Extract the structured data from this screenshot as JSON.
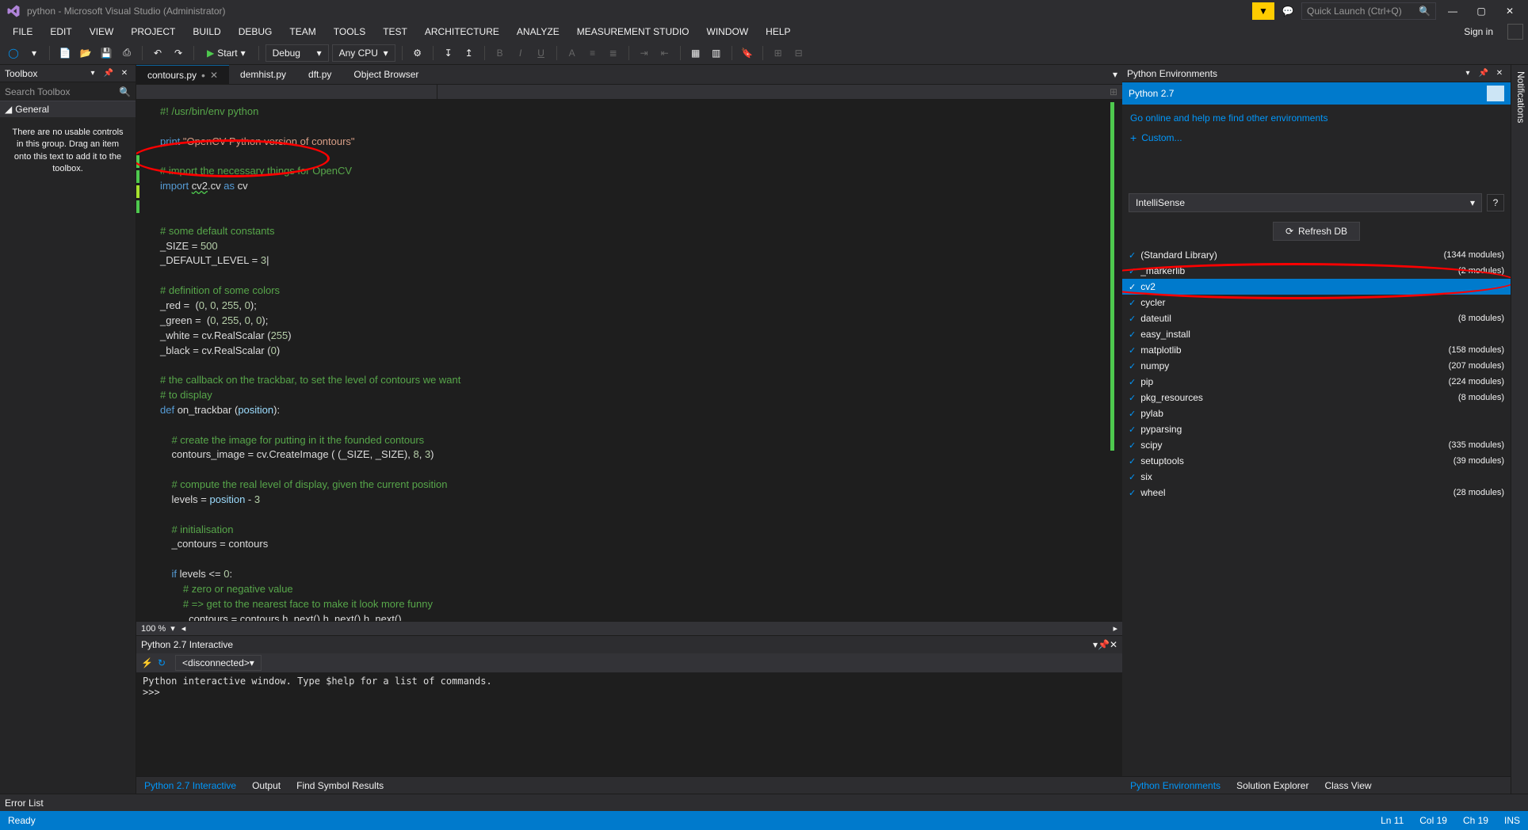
{
  "window": {
    "title": "python - Microsoft Visual Studio (Administrator)",
    "quickLaunchPlaceholder": "Quick Launch (Ctrl+Q)",
    "signIn": "Sign in"
  },
  "menus": [
    "FILE",
    "EDIT",
    "VIEW",
    "PROJECT",
    "BUILD",
    "DEBUG",
    "TEAM",
    "TOOLS",
    "TEST",
    "ARCHITECTURE",
    "ANALYZE",
    "MEASUREMENT STUDIO",
    "WINDOW",
    "HELP"
  ],
  "toolbar": {
    "start": "Start",
    "config": "Debug",
    "platform": "Any CPU"
  },
  "toolbox": {
    "title": "Toolbox",
    "searchPlaceholder": "Search Toolbox",
    "category": "General",
    "message": "There are no usable controls in this group. Drag an item onto this text to add it to the toolbox."
  },
  "tabs": [
    {
      "label": "contours.py",
      "active": true,
      "dirty": true
    },
    {
      "label": "demhist.py",
      "active": false
    },
    {
      "label": "dft.py",
      "active": false
    },
    {
      "label": "Object Browser",
      "active": false
    }
  ],
  "code": "#! /usr/bin/env python\n\nprint \"OpenCV Python version of contours\"\n\n# import the necessary things for OpenCV\nimport cv2.cv as cv\n\n\n# some default constants\n_SIZE = 500\n_DEFAULT_LEVEL = 3\n\n# definition of some colors\n_red =  (0, 0, 255, 0);\n_green =  (0, 255, 0, 0);\n_white = cv.RealScalar (255)\n_black = cv.RealScalar (0)\n\n# the callback on the trackbar, to set the level of contours we want\n# to display\ndef on_trackbar (position):\n\n    # create the image for putting in it the founded contours\n    contours_image = cv.CreateImage ( (_SIZE, _SIZE), 8, 3)\n\n    # compute the real level of display, given the current position\n    levels = position - 3\n\n    # initialisation\n    _contours = contours\n\n    if levels <= 0:\n        # zero or negative value\n        # => get to the nearest face to make it look more funny\n        _contours = contours.h_next().h_next().h_next()",
  "zoom": "100 %",
  "interactive": {
    "title": "Python 2.7 Interactive",
    "state": "<disconnected>",
    "body": "Python interactive window. Type $help for a list of commands.\n>>>",
    "tabs": [
      "Python 2.7 Interactive",
      "Output",
      "Find Symbol Results"
    ]
  },
  "pyenv": {
    "title": "Python Environments",
    "envName": "Python 2.7",
    "link": "Go online and help me find other environments",
    "custom": "Custom...",
    "dropdown": "IntelliSense",
    "refresh": "Refresh DB",
    "modules": [
      {
        "name": "(Standard Library)",
        "count": "(1344 modules)"
      },
      {
        "name": "_markerlib",
        "count": "(2 modules)"
      },
      {
        "name": "cv2",
        "count": "",
        "selected": true
      },
      {
        "name": "cycler",
        "count": ""
      },
      {
        "name": "dateutil",
        "count": "(8 modules)"
      },
      {
        "name": "easy_install",
        "count": ""
      },
      {
        "name": "matplotlib",
        "count": "(158 modules)"
      },
      {
        "name": "numpy",
        "count": "(207 modules)"
      },
      {
        "name": "pip",
        "count": "(224 modules)"
      },
      {
        "name": "pkg_resources",
        "count": "(8 modules)"
      },
      {
        "name": "pylab",
        "count": ""
      },
      {
        "name": "pyparsing",
        "count": ""
      },
      {
        "name": "scipy",
        "count": "(335 modules)"
      },
      {
        "name": "setuptools",
        "count": "(39 modules)"
      },
      {
        "name": "six",
        "count": ""
      },
      {
        "name": "wheel",
        "count": "(28 modules)"
      }
    ],
    "tabs": [
      "Python Environments",
      "Solution Explorer",
      "Class View"
    ]
  },
  "errorList": "Error List",
  "statusbar": {
    "ready": "Ready",
    "ln": "Ln 11",
    "col": "Col 19",
    "ch": "Ch 19",
    "ins": "INS"
  },
  "notifications": "Notifications"
}
